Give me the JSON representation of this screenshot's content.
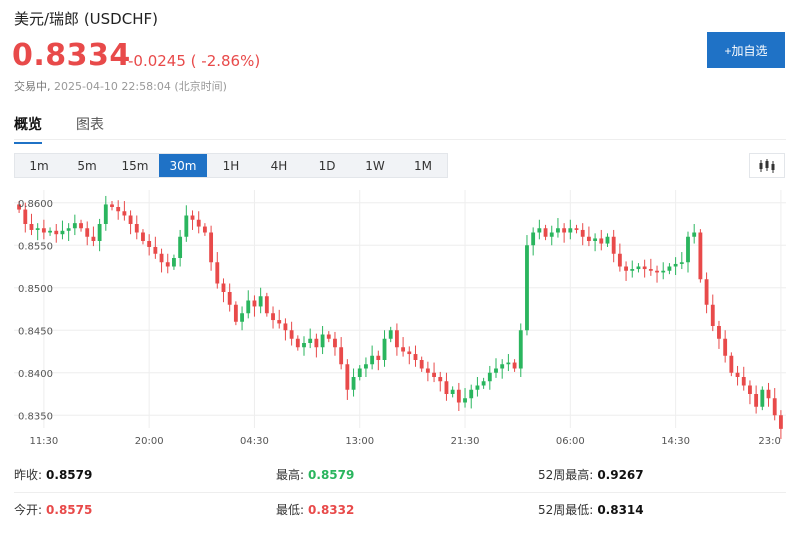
{
  "header": {
    "title": "美元/瑞郎 (USDCHF)",
    "price": "0.8334",
    "change": "-0.0245 ( -2.86%)",
    "status_label": "交易中,",
    "timestamp": "2025-04-10 22:58:04 (北京时间)",
    "add_watchlist_label": "+加自选"
  },
  "tabs": [
    {
      "label": "概览",
      "active": true
    },
    {
      "label": "图表",
      "active": false
    }
  ],
  "intervals": [
    {
      "label": "1m",
      "active": false
    },
    {
      "label": "5m",
      "active": false
    },
    {
      "label": "15m",
      "active": false
    },
    {
      "label": "30m",
      "active": true
    },
    {
      "label": "1H",
      "active": false
    },
    {
      "label": "4H",
      "active": false
    },
    {
      "label": "1D",
      "active": false
    },
    {
      "label": "1W",
      "active": false
    },
    {
      "label": "1M",
      "active": false
    }
  ],
  "colors": {
    "up": "#2ab55e",
    "down": "#e84a4a",
    "accent": "#1f72c6",
    "grid": "#eeeeee"
  },
  "chart_data": {
    "type": "candlestick",
    "interval": "30m",
    "y_ticks": [
      "0.8600",
      "0.8550",
      "0.8500",
      "0.8450",
      "0.8400",
      "0.8350"
    ],
    "ylim": [
      0.8335,
      0.8615
    ],
    "x_ticks": [
      "11:30",
      "20:00",
      "04:30",
      "13:00",
      "21:30",
      "06:00",
      "14:30",
      "23:0"
    ],
    "x_tick_index": [
      4,
      21,
      38,
      55,
      72,
      89,
      106,
      123
    ],
    "closes": [
      0.8592,
      0.8575,
      0.8568,
      0.857,
      0.8565,
      0.8567,
      0.8563,
      0.8567,
      0.857,
      0.8576,
      0.857,
      0.856,
      0.8555,
      0.8575,
      0.8598,
      0.8595,
      0.859,
      0.8585,
      0.8575,
      0.8565,
      0.8555,
      0.8548,
      0.854,
      0.853,
      0.8525,
      0.8535,
      0.856,
      0.8585,
      0.858,
      0.8572,
      0.8565,
      0.853,
      0.8505,
      0.8495,
      0.848,
      0.846,
      0.847,
      0.8485,
      0.8478,
      0.849,
      0.847,
      0.8462,
      0.8458,
      0.845,
      0.844,
      0.843,
      0.8435,
      0.844,
      0.843,
      0.8445,
      0.844,
      0.843,
      0.841,
      0.838,
      0.8395,
      0.8405,
      0.841,
      0.842,
      0.8415,
      0.844,
      0.845,
      0.843,
      0.8425,
      0.8422,
      0.8415,
      0.8405,
      0.84,
      0.8395,
      0.839,
      0.8375,
      0.838,
      0.8365,
      0.837,
      0.838,
      0.8385,
      0.839,
      0.84,
      0.8405,
      0.841,
      0.8412,
      0.8405,
      0.845,
      0.855,
      0.8565,
      0.857,
      0.856,
      0.8565,
      0.857,
      0.8565,
      0.857,
      0.8568,
      0.856,
      0.8555,
      0.8558,
      0.8552,
      0.856,
      0.854,
      0.8525,
      0.852,
      0.8522,
      0.8525,
      0.8522,
      0.852,
      0.8518,
      0.852,
      0.8525,
      0.8528,
      0.853,
      0.856,
      0.8565,
      0.851,
      0.848,
      0.8455,
      0.844,
      0.842,
      0.84,
      0.8395,
      0.8385,
      0.8375,
      0.836,
      0.838,
      0.837,
      0.835,
      0.8334
    ]
  },
  "stats": [
    [
      {
        "label": "昨收:",
        "value": "0.8579",
        "tone": "plain"
      },
      {
        "label": "最高:",
        "value": "0.8579",
        "tone": "up"
      },
      {
        "label": "52周最高:",
        "value": "0.9267",
        "tone": "plain"
      }
    ],
    [
      {
        "label": "今开:",
        "value": "0.8575",
        "tone": "down"
      },
      {
        "label": "最低:",
        "value": "0.8332",
        "tone": "down"
      },
      {
        "label": "52周最低:",
        "value": "0.8314",
        "tone": "plain"
      }
    ]
  ]
}
